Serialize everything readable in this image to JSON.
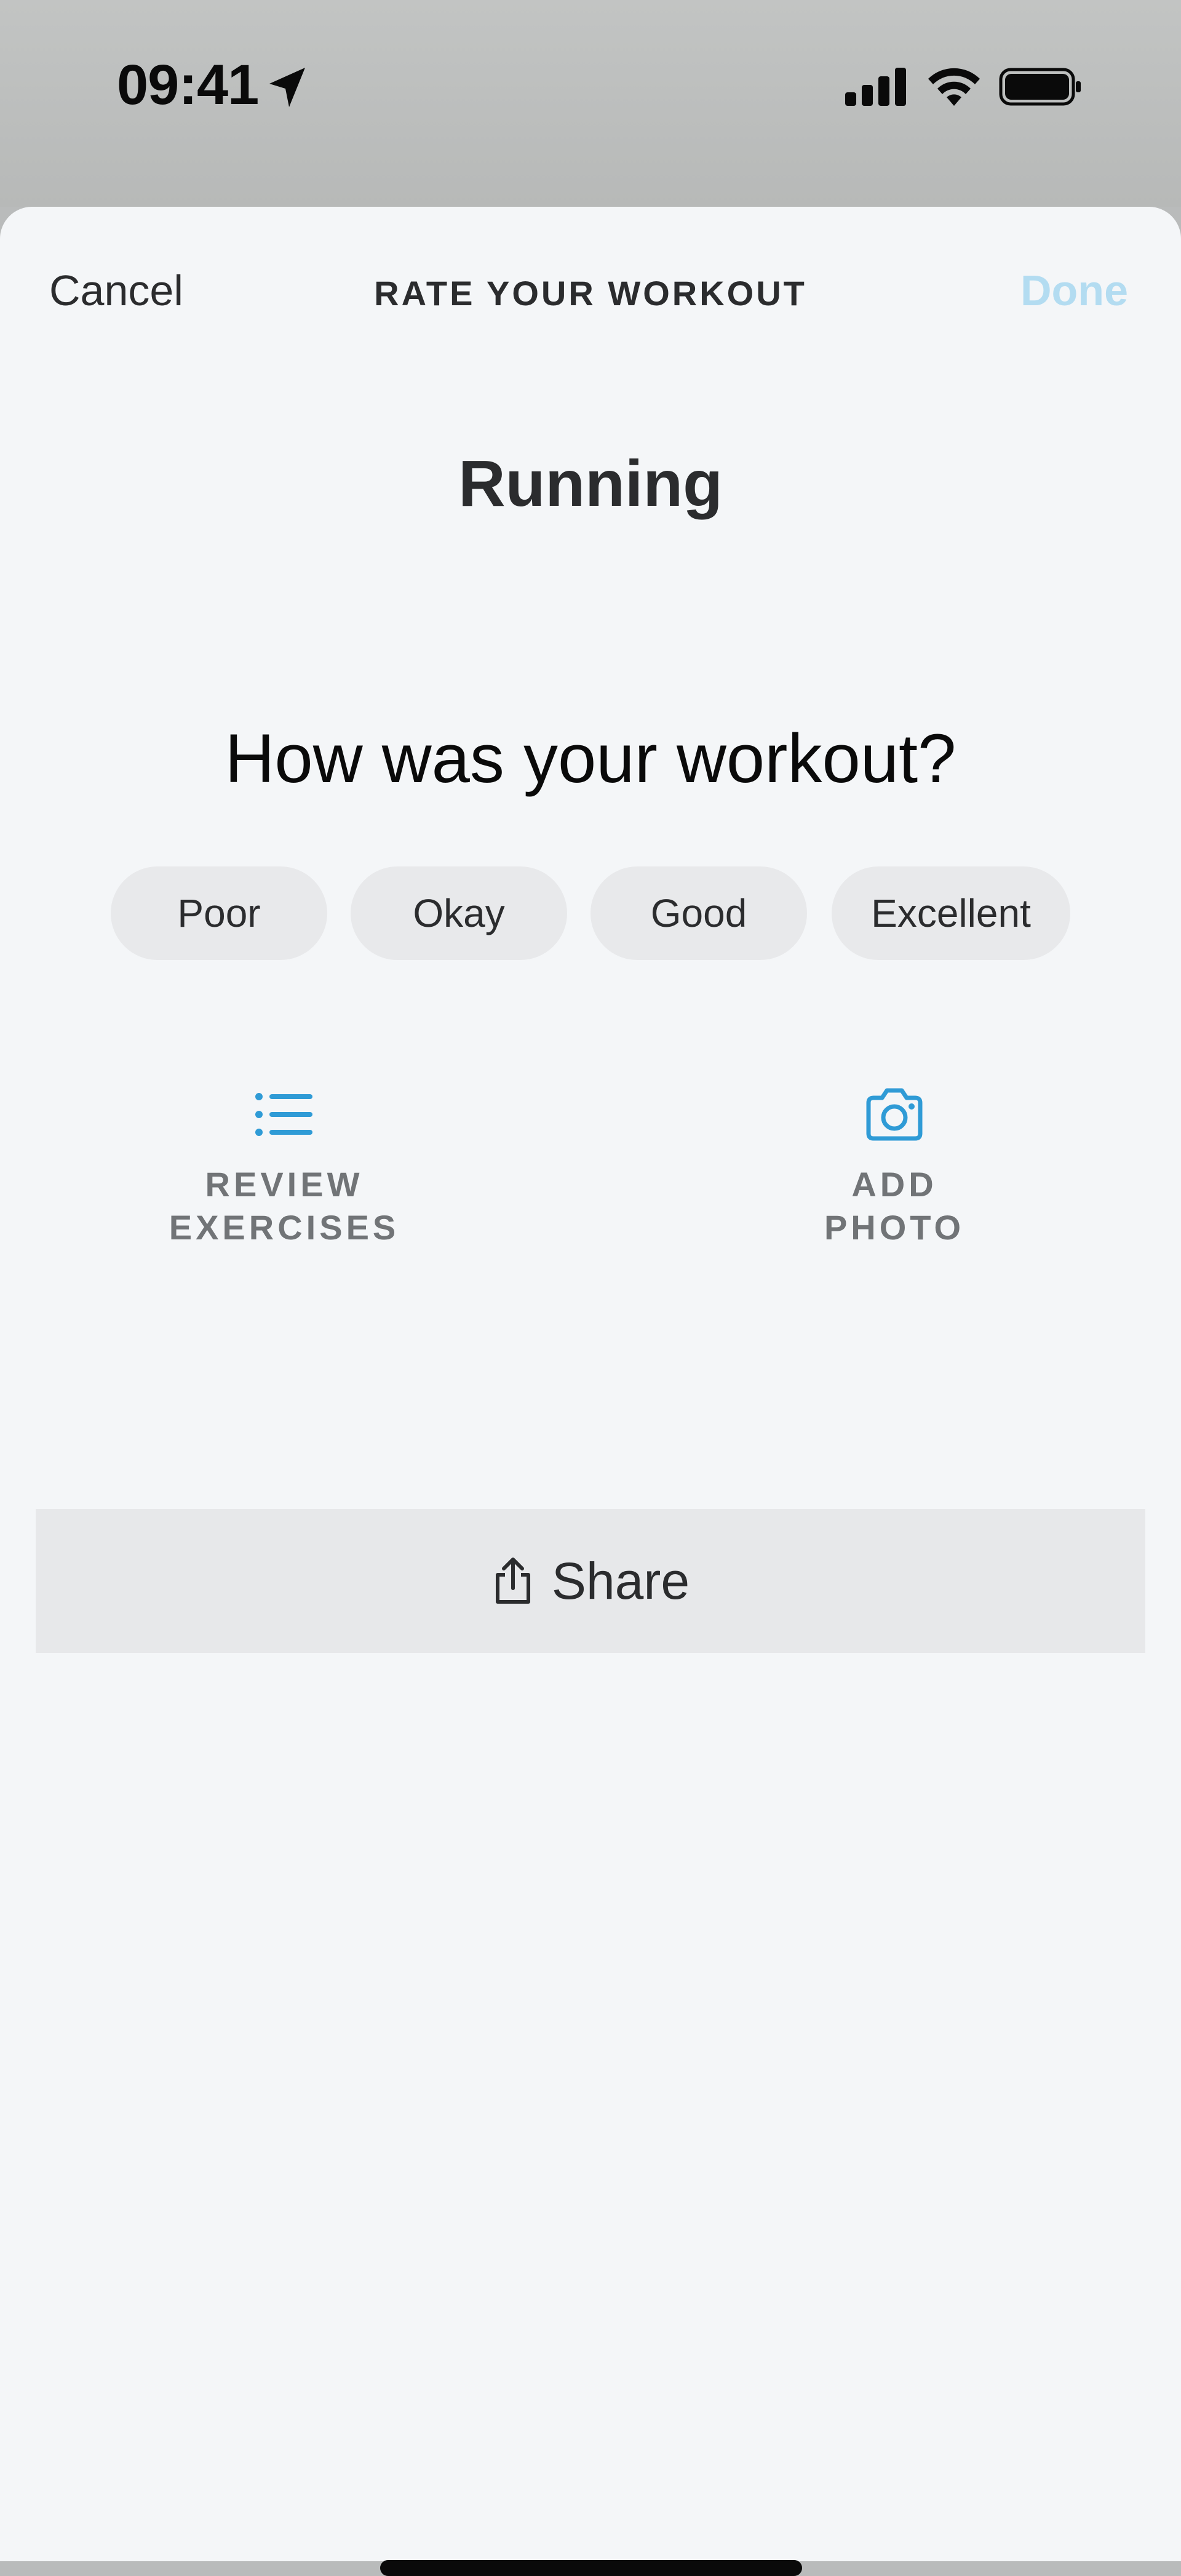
{
  "status_bar": {
    "time": "09:41",
    "icons": [
      "location-arrow-icon",
      "cellular-signal-icon",
      "wifi-icon",
      "battery-icon"
    ]
  },
  "sheet": {
    "cancel_label": "Cancel",
    "title": "RATE YOUR WORKOUT",
    "done_label": "Done",
    "done_color": "#b3dcf1"
  },
  "workout": {
    "name": "Running"
  },
  "rating": {
    "question": "How was your workout?",
    "options": [
      "Poor",
      "Okay",
      "Good",
      "Excellent"
    ]
  },
  "actions": {
    "review_exercises": {
      "label": "REVIEW\nEXERCISES",
      "icon": "list-icon"
    },
    "add_photo": {
      "label": "ADD\nPHOTO",
      "icon": "camera-icon"
    },
    "accent_color": "#2f9bd6"
  },
  "share": {
    "label": "Share",
    "icon": "share-icon"
  }
}
